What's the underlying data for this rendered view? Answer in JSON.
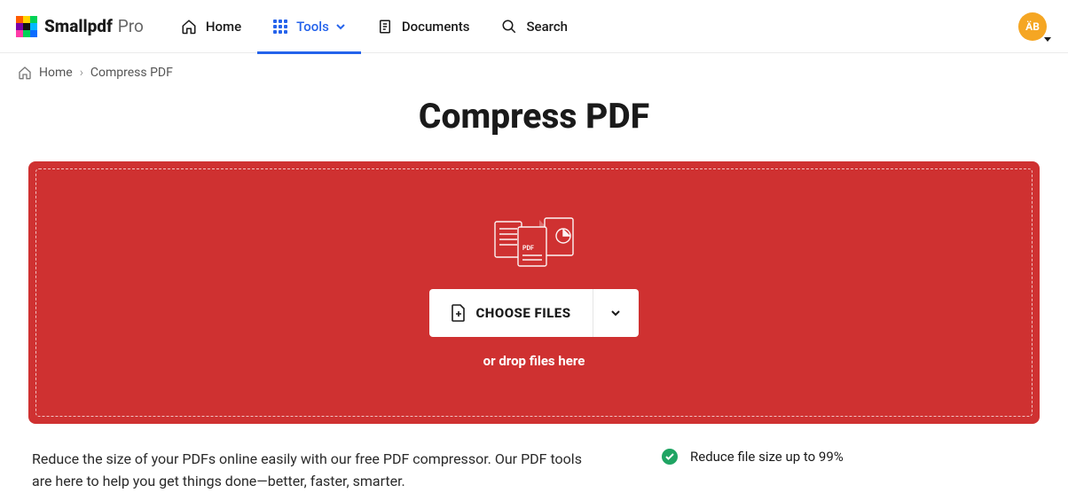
{
  "brand": {
    "name": "Smallpdf",
    "tier": "Pro"
  },
  "nav": {
    "home": "Home",
    "tools": "Tools",
    "documents": "Documents",
    "search": "Search"
  },
  "avatar": {
    "initials": "ÄB"
  },
  "breadcrumb": {
    "home": "Home",
    "current": "Compress PDF"
  },
  "page": {
    "title": "Compress PDF"
  },
  "dropzone": {
    "choose": "CHOOSE FILES",
    "sub": "or drop files here"
  },
  "description": "Reduce the size of your PDFs online easily with our free PDF compressor. Our PDF tools are here to help you get things done—better, faster, smarter.",
  "benefits": [
    "Reduce file size up to 99%"
  ]
}
